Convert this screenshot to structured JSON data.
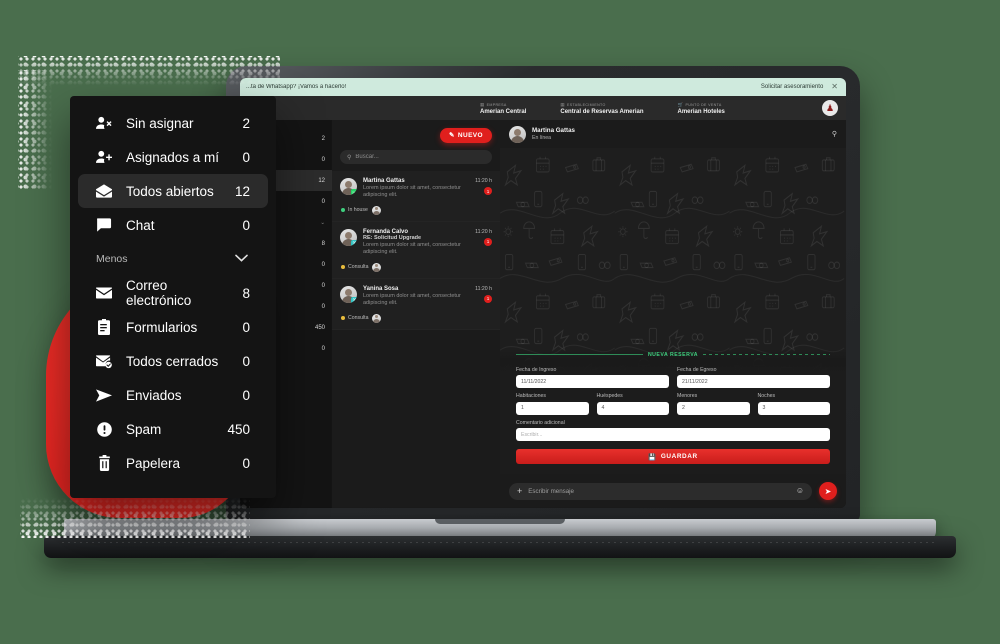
{
  "background_color": "#4a6e4d",
  "accent_color": "#e01f1d",
  "promo": {
    "text": "...ta de Whatsapp? ¡Vamos a hacerlo!",
    "link": "Solicitar asesoramiento",
    "close_icon": "close-icon"
  },
  "context_bar": {
    "items": [
      {
        "kicker": "EMPRESA",
        "icon": "building-icon",
        "value": "Amerian Central"
      },
      {
        "kicker": "ESTABLECIMIENTO",
        "icon": "store-icon",
        "value": "Central de Reservas Amerian"
      },
      {
        "kicker": "PUNTO DE VENTA",
        "icon": "cart-icon",
        "value": "Amerian Hoteles"
      }
    ],
    "avatar": "avatar"
  },
  "rail": {
    "items": [
      {
        "label": "",
        "count": "2",
        "active": false,
        "muted": false
      },
      {
        "label": "s a mí",
        "count": "0",
        "active": false,
        "muted": false
      },
      {
        "label": "rtos",
        "count": "12",
        "active": true,
        "muted": false
      },
      {
        "label": "",
        "count": "0",
        "active": false,
        "muted": false
      },
      {
        "label": "",
        "count": "⌄",
        "active": false,
        "muted": true
      },
      {
        "label": "trónico",
        "count": "8",
        "active": false,
        "muted": false
      },
      {
        "label": "s",
        "count": "0",
        "active": false,
        "muted": false
      },
      {
        "label": "ados",
        "count": "0",
        "active": false,
        "muted": false
      },
      {
        "label": "",
        "count": "0",
        "active": false,
        "muted": false
      },
      {
        "label": "",
        "count": "450",
        "active": false,
        "muted": false
      },
      {
        "label": "",
        "count": "0",
        "active": false,
        "muted": false
      }
    ]
  },
  "convo_panel": {
    "new_button": {
      "label": "NUEVO",
      "icon": "pencil-icon"
    },
    "search": {
      "placeholder": "Buscar...",
      "value": "",
      "icon": "search-icon"
    },
    "items": [
      {
        "name": "Martina Gattas",
        "subject": "",
        "snippet": "Lorem ipsum dolor sit amet, consectetur adipiscing elit.",
        "time": "11:20 h",
        "unread": "1",
        "channel_icon": "whatsapp-icon",
        "channel": "whatsapp",
        "tag": {
          "label": "In house",
          "color": "#3ecf7e"
        }
      },
      {
        "name": "Fernanda Calvo",
        "subject": "RE: Solicitud Upgrade",
        "snippet": "Lorem ipsum dolor sit amet, consectetur adipiscing elit.",
        "time": "11:20 h",
        "unread": "1",
        "channel_icon": "email-icon",
        "channel": "email",
        "tag": {
          "label": "Consulta",
          "color": "#e8bc3c"
        }
      },
      {
        "name": "Yanina Sosa",
        "subject": "",
        "snippet": "Lorem ipsum dolor sit amet, consectetur adipiscing elit.",
        "time": "11:20 h",
        "unread": "1",
        "channel_icon": "email-icon",
        "channel": "email",
        "tag": {
          "label": "Consulta",
          "color": "#e8bc3c"
        }
      }
    ]
  },
  "chat": {
    "contact_name": "Martina Gattas",
    "contact_status": "En línea",
    "search_icon": "search-icon",
    "composer": {
      "placeholder": "Escribir mensaje",
      "value": "",
      "plus_icon": "plus-icon",
      "emoji_icon": "emoji-icon",
      "send_icon": "send-icon"
    }
  },
  "reserva": {
    "title": "NUEVA RESERVA",
    "fecha_ingreso": {
      "label": "Fecha de Ingreso",
      "value": "11/11/2022"
    },
    "fecha_egreso": {
      "label": "Fecha de Egreso",
      "value": "21/11/2022"
    },
    "habitaciones": {
      "label": "Habitaciones",
      "value": "1"
    },
    "huespedes": {
      "label": "Huéspedes",
      "value": "4"
    },
    "menores": {
      "label": "Menores",
      "value": "2"
    },
    "noches": {
      "label": "Noches",
      "value": "3"
    },
    "comentario": {
      "label": "Comentario adicional",
      "placeholder": "Escribir...",
      "value": ""
    },
    "save_button": {
      "label": "GUARDAR",
      "icon": "save-icon"
    }
  },
  "folder_menu": {
    "items": [
      {
        "label": "Sin asignar",
        "count": "2",
        "icon": "user-remove-icon",
        "active": false
      },
      {
        "label": "Asignados a mí",
        "count": "0",
        "icon": "user-add-icon",
        "active": false
      },
      {
        "label": "Todos abiertos",
        "count": "12",
        "icon": "envelope-open-icon",
        "active": true
      },
      {
        "label": "Chat",
        "count": "0",
        "icon": "chat-bubble-icon",
        "active": false
      }
    ],
    "section": {
      "label": "Menos",
      "chevron_icon": "chevron-down-icon"
    },
    "items2": [
      {
        "label": "Correo electrónico",
        "count": "8",
        "icon": "envelope-icon",
        "active": false
      },
      {
        "label": "Formularios",
        "count": "0",
        "icon": "clipboard-icon",
        "active": false
      },
      {
        "label": "Todos cerrados",
        "count": "0",
        "icon": "envelope-check-icon",
        "active": false
      },
      {
        "label": "Enviados",
        "count": "0",
        "icon": "send-icon",
        "active": false
      },
      {
        "label": "Spam",
        "count": "450",
        "icon": "alert-circle-icon",
        "active": false
      },
      {
        "label": "Papelera",
        "count": "0",
        "icon": "trash-icon",
        "active": false
      }
    ]
  }
}
